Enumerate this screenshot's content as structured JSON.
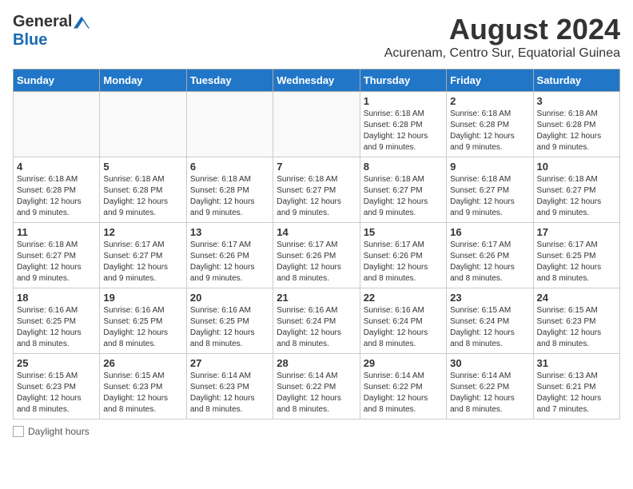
{
  "logo": {
    "general": "General",
    "blue": "Blue"
  },
  "header": {
    "title": "August 2024",
    "subtitle": "Acurenam, Centro Sur, Equatorial Guinea"
  },
  "days_of_week": [
    "Sunday",
    "Monday",
    "Tuesday",
    "Wednesday",
    "Thursday",
    "Friday",
    "Saturday"
  ],
  "weeks": [
    [
      {
        "day": "",
        "sunrise": "",
        "sunset": "",
        "daylight": ""
      },
      {
        "day": "",
        "sunrise": "",
        "sunset": "",
        "daylight": ""
      },
      {
        "day": "",
        "sunrise": "",
        "sunset": "",
        "daylight": ""
      },
      {
        "day": "",
        "sunrise": "",
        "sunset": "",
        "daylight": ""
      },
      {
        "day": "1",
        "sunrise": "6:18 AM",
        "sunset": "6:28 PM",
        "daylight": "12 hours and 9 minutes."
      },
      {
        "day": "2",
        "sunrise": "6:18 AM",
        "sunset": "6:28 PM",
        "daylight": "12 hours and 9 minutes."
      },
      {
        "day": "3",
        "sunrise": "6:18 AM",
        "sunset": "6:28 PM",
        "daylight": "12 hours and 9 minutes."
      }
    ],
    [
      {
        "day": "4",
        "sunrise": "6:18 AM",
        "sunset": "6:28 PM",
        "daylight": "12 hours and 9 minutes."
      },
      {
        "day": "5",
        "sunrise": "6:18 AM",
        "sunset": "6:28 PM",
        "daylight": "12 hours and 9 minutes."
      },
      {
        "day": "6",
        "sunrise": "6:18 AM",
        "sunset": "6:28 PM",
        "daylight": "12 hours and 9 minutes."
      },
      {
        "day": "7",
        "sunrise": "6:18 AM",
        "sunset": "6:27 PM",
        "daylight": "12 hours and 9 minutes."
      },
      {
        "day": "8",
        "sunrise": "6:18 AM",
        "sunset": "6:27 PM",
        "daylight": "12 hours and 9 minutes."
      },
      {
        "day": "9",
        "sunrise": "6:18 AM",
        "sunset": "6:27 PM",
        "daylight": "12 hours and 9 minutes."
      },
      {
        "day": "10",
        "sunrise": "6:18 AM",
        "sunset": "6:27 PM",
        "daylight": "12 hours and 9 minutes."
      }
    ],
    [
      {
        "day": "11",
        "sunrise": "6:18 AM",
        "sunset": "6:27 PM",
        "daylight": "12 hours and 9 minutes."
      },
      {
        "day": "12",
        "sunrise": "6:17 AM",
        "sunset": "6:27 PM",
        "daylight": "12 hours and 9 minutes."
      },
      {
        "day": "13",
        "sunrise": "6:17 AM",
        "sunset": "6:26 PM",
        "daylight": "12 hours and 9 minutes."
      },
      {
        "day": "14",
        "sunrise": "6:17 AM",
        "sunset": "6:26 PM",
        "daylight": "12 hours and 8 minutes."
      },
      {
        "day": "15",
        "sunrise": "6:17 AM",
        "sunset": "6:26 PM",
        "daylight": "12 hours and 8 minutes."
      },
      {
        "day": "16",
        "sunrise": "6:17 AM",
        "sunset": "6:26 PM",
        "daylight": "12 hours and 8 minutes."
      },
      {
        "day": "17",
        "sunrise": "6:17 AM",
        "sunset": "6:25 PM",
        "daylight": "12 hours and 8 minutes."
      }
    ],
    [
      {
        "day": "18",
        "sunrise": "6:16 AM",
        "sunset": "6:25 PM",
        "daylight": "12 hours and 8 minutes."
      },
      {
        "day": "19",
        "sunrise": "6:16 AM",
        "sunset": "6:25 PM",
        "daylight": "12 hours and 8 minutes."
      },
      {
        "day": "20",
        "sunrise": "6:16 AM",
        "sunset": "6:25 PM",
        "daylight": "12 hours and 8 minutes."
      },
      {
        "day": "21",
        "sunrise": "6:16 AM",
        "sunset": "6:24 PM",
        "daylight": "12 hours and 8 minutes."
      },
      {
        "day": "22",
        "sunrise": "6:16 AM",
        "sunset": "6:24 PM",
        "daylight": "12 hours and 8 minutes."
      },
      {
        "day": "23",
        "sunrise": "6:15 AM",
        "sunset": "6:24 PM",
        "daylight": "12 hours and 8 minutes."
      },
      {
        "day": "24",
        "sunrise": "6:15 AM",
        "sunset": "6:23 PM",
        "daylight": "12 hours and 8 minutes."
      }
    ],
    [
      {
        "day": "25",
        "sunrise": "6:15 AM",
        "sunset": "6:23 PM",
        "daylight": "12 hours and 8 minutes."
      },
      {
        "day": "26",
        "sunrise": "6:15 AM",
        "sunset": "6:23 PM",
        "daylight": "12 hours and 8 minutes."
      },
      {
        "day": "27",
        "sunrise": "6:14 AM",
        "sunset": "6:23 PM",
        "daylight": "12 hours and 8 minutes."
      },
      {
        "day": "28",
        "sunrise": "6:14 AM",
        "sunset": "6:22 PM",
        "daylight": "12 hours and 8 minutes."
      },
      {
        "day": "29",
        "sunrise": "6:14 AM",
        "sunset": "6:22 PM",
        "daylight": "12 hours and 8 minutes."
      },
      {
        "day": "30",
        "sunrise": "6:14 AM",
        "sunset": "6:22 PM",
        "daylight": "12 hours and 8 minutes."
      },
      {
        "day": "31",
        "sunrise": "6:13 AM",
        "sunset": "6:21 PM",
        "daylight": "12 hours and 7 minutes."
      }
    ]
  ],
  "legend": {
    "label": "Daylight hours"
  }
}
